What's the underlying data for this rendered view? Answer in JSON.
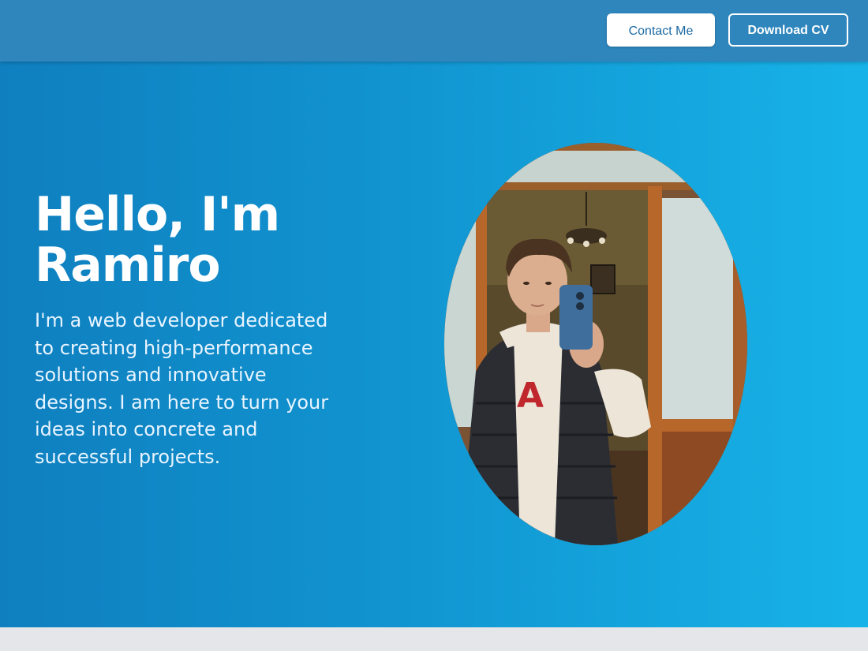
{
  "header": {
    "contact_label": "Contact Me",
    "download_label": "Download CV"
  },
  "hero": {
    "title_line1": "Hello, I'm",
    "title_line2": "Ramiro",
    "description": "I'm a web developer dedicated to creating high-performance solutions and innovative designs. I am here to turn your ideas into concrete and successful projects."
  },
  "colors": {
    "header_bg": "#2f86bd",
    "hero_gradient_start": "#0f7fbf",
    "hero_gradient_end": "#17b3e8",
    "contact_text": "#1c6aa3",
    "footer_strip": "#e4e6e9"
  }
}
